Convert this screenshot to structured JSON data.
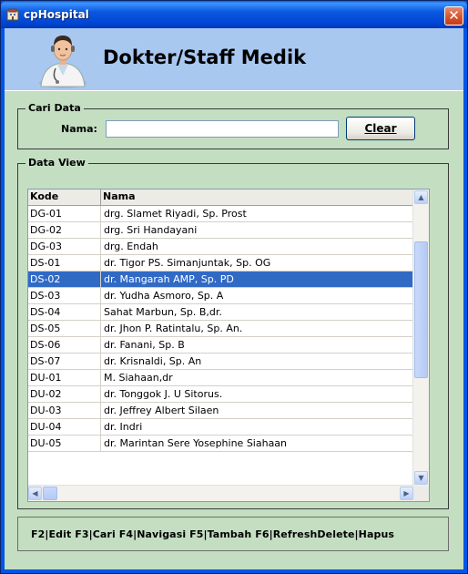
{
  "window": {
    "title": "cpHospital"
  },
  "header": {
    "title": "Dokter/Staff Medik"
  },
  "search": {
    "group_label": "Cari Data",
    "name_label": "Nama:",
    "name_value": "",
    "clear_label": "Clear"
  },
  "data_view": {
    "group_label": "Data View",
    "columns": [
      "Kode",
      "Nama"
    ],
    "selected_row": 4,
    "rows": [
      [
        "DG-01",
        "drg. Slamet Riyadi, Sp. Prost"
      ],
      [
        "DG-02",
        "drg. Sri Handayani"
      ],
      [
        "DG-03",
        "drg. Endah"
      ],
      [
        "DS-01",
        "dr. Tigor PS. Simanjuntak, Sp. OG"
      ],
      [
        "DS-02",
        "dr. Mangarah AMP, Sp. PD"
      ],
      [
        "DS-03",
        "dr. Yudha Asmoro, Sp. A"
      ],
      [
        "DS-04",
        "Sahat Marbun, Sp. B,dr."
      ],
      [
        "DS-05",
        "dr. Jhon P. Ratintalu, Sp. An."
      ],
      [
        "DS-06",
        "dr. Fanani, Sp. B"
      ],
      [
        "DS-07",
        "dr. Krisnaldi, Sp. An"
      ],
      [
        "DU-01",
        "M. Siahaan,dr"
      ],
      [
        "DU-02",
        "dr. Tonggok J. U Sitorus."
      ],
      [
        "DU-03",
        "dr. Jeffrey Albert Silaen"
      ],
      [
        "DU-04",
        "dr. Indri"
      ],
      [
        "DU-05",
        "dr. Marintan Sere Yosephine Siahaan"
      ]
    ]
  },
  "footer": {
    "shortcuts": "F2|Edit  F3|Cari  F4|Navigasi  F5|Tambah  F6|RefreshDelete|Hapus"
  },
  "colors": {
    "titlebar": "#0055e5",
    "client_bg": "#c4dec2",
    "header_bg": "#a8c8f0",
    "selection": "#316ac5"
  },
  "icons": {
    "app": "hospital-app-icon",
    "close": "close-icon",
    "header": "doctor-icon"
  }
}
